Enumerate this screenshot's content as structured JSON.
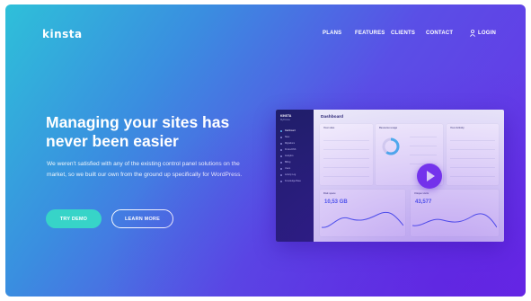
{
  "brand": {
    "logo": "kinsta"
  },
  "nav": {
    "items": [
      "PLANS",
      "FEATURES",
      "CLIENTS",
      "CONTACT"
    ],
    "login_label": "LOGIN",
    "login_icon": "user-icon"
  },
  "hero": {
    "title": "Managing your sites has never been easier",
    "text": "We weren't satisfied with any of the existing control panel solutions on the market, so we built our own from the ground up specifically for WordPress.",
    "cta_primary": "TRY DEMO",
    "cta_secondary": "LEARN MORE"
  },
  "dashboard": {
    "title": "Dashboard",
    "sidebar_brand": "KINSTA",
    "sidebar_sub": "MyKinsta",
    "sidebar_items": [
      "Dashboard",
      "Sites",
      "Migrations",
      "Kinsta DNS",
      "Analytics",
      "Billing",
      "Users",
      "Activity Log",
      "Knowledge Base"
    ],
    "cards": {
      "your_sites": "Your sites",
      "resource_usage": "Resource usage",
      "activity": "Your Activity",
      "unique_visits": "Unique visits",
      "disk_space": "Disk space"
    },
    "disk_value": "10,53 GB",
    "visits_value": "43,577"
  },
  "colors": {
    "accent": "#37d4c8",
    "play": "#7b3cf0",
    "sidebar": "#1e1f66",
    "gradient_start": "#2ec0d9",
    "gradient_end": "#6a2de8"
  },
  "icons": {
    "play": "play-icon",
    "donut": "donut-chart-icon"
  }
}
